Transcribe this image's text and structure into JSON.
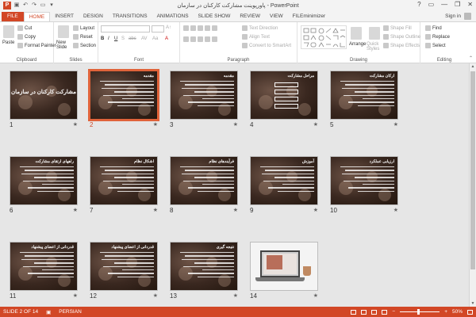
{
  "window": {
    "title": "پاورپوینت مشارکت کارکنان در سازمان - PowerPoint",
    "minimize": "—",
    "restore": "❐",
    "close": "✕",
    "help": "?"
  },
  "account": {
    "signin": "Sign in"
  },
  "tabs": [
    "FILE",
    "HOME",
    "INSERT",
    "DESIGN",
    "TRANSITIONS",
    "ANIMATIONS",
    "SLIDE SHOW",
    "REVIEW",
    "VIEW",
    "FILEminimizer"
  ],
  "active_tab": "HOME",
  "ribbon": {
    "clipboard": {
      "paste": "Paste",
      "cut": "Cut",
      "copy": "Copy",
      "format_painter": "Format Painter",
      "name": "Clipboard"
    },
    "slides": {
      "new_slide": "New Slide",
      "layout": "Layout",
      "reset": "Reset",
      "section": "Section",
      "name": "Slides"
    },
    "font": {
      "name": "Font",
      "bold": "B",
      "italic": "I",
      "underline": "U",
      "strike": "S",
      "abc": "abc",
      "av": "AV",
      "aa": "Aa",
      "font_color": "A"
    },
    "paragraph": {
      "text_direction": "Text Direction",
      "align_text": "Align Text",
      "smartart": "Convert to SmartArt",
      "name": "Paragraph"
    },
    "drawing": {
      "arrange": "Arrange",
      "quick_styles": "Quick Styles",
      "shape_fill": "Shape Fill",
      "shape_outline": "Shape Outline",
      "shape_effects": "Shape Effects",
      "name": "Drawing"
    },
    "editing": {
      "find": "Find",
      "replace": "Replace",
      "select": "Select",
      "name": "Editing"
    }
  },
  "slides": [
    {
      "num": "1",
      "title": "مشارکت کارکنان در سازمان",
      "kind": "title"
    },
    {
      "num": "2",
      "title": "مقدمه",
      "kind": "text",
      "selected": true
    },
    {
      "num": "3",
      "title": "مقدمه",
      "kind": "text"
    },
    {
      "num": "4",
      "title": "مراحل مشارکت",
      "kind": "flow"
    },
    {
      "num": "5",
      "title": "ارکان مشارکت",
      "kind": "text"
    },
    {
      "num": "6",
      "title": "راههای ارتقای مشارکت",
      "kind": "text"
    },
    {
      "num": "7",
      "title": "اشکال نظام",
      "kind": "text"
    },
    {
      "num": "8",
      "title": "فرآیندهای نظام",
      "kind": "text"
    },
    {
      "num": "9",
      "title": "آموزش",
      "kind": "text"
    },
    {
      "num": "10",
      "title": "ارزیابی عملکرد",
      "kind": "text"
    },
    {
      "num": "11",
      "title": "قدردانی از اعضای پیشنهاد",
      "kind": "text"
    },
    {
      "num": "12",
      "title": "قدردانی از اعضای پیشنهاد",
      "kind": "text"
    },
    {
      "num": "13",
      "title": "نتیجه گیری",
      "kind": "text"
    },
    {
      "num": "14",
      "title": "",
      "kind": "photo"
    }
  ],
  "status": {
    "slide": "SLIDE 2 OF 14",
    "language": "PERSIAN",
    "zoom": "50%"
  },
  "colors": {
    "accent": "#d24726",
    "selection": "#e0633a"
  }
}
